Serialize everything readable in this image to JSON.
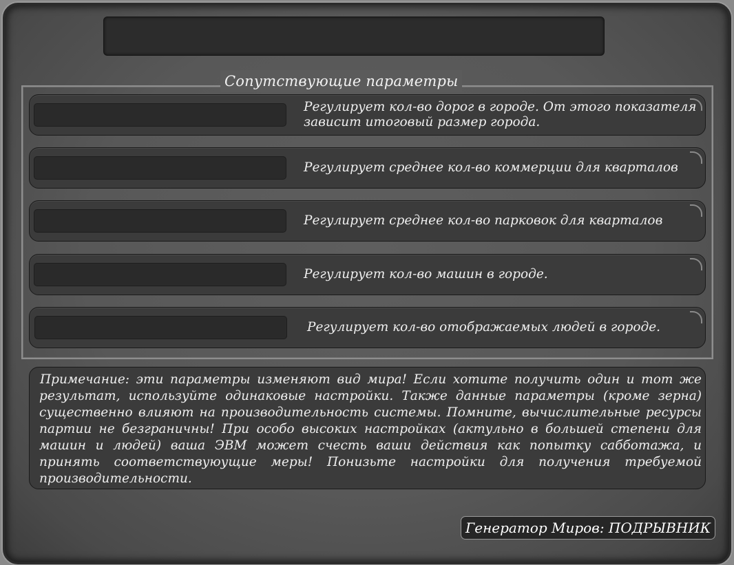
{
  "group": {
    "title": "Сопутствующие параметры"
  },
  "params": [
    {
      "description": "Регулирует кол-во дорог в городе. От этого показателя зависит итоговый размер города."
    },
    {
      "description": "Регулирует среднее кол-во коммерции для кварталов"
    },
    {
      "description": "Регулирует среднее кол-во парковок для кварталов"
    },
    {
      "description": "Регулирует кол-во машин в городе."
    },
    {
      "description": "Регулирует кол-во отображаемых людей в городе."
    }
  ],
  "note": {
    "text": "Примечание: эти параметры изменяют вид мира! Если хотите получить один и тот же результат, используйте одинаковые настройки. Также данные параметры (кроме зерна) существенно влияют на производительность системы. Помните, вычислительные ресурсы партии не безграничны! При особо высоких настройках (актульно в большей степени для машин и людей) ваша ЭВМ может счесть ваши действия как попытку саббота­жа, и принять соответствуюущие меры! Понизьте настройки для получения требуемой производительности."
  },
  "brand": {
    "label": "Генератор Миров: ПОДРЫВНИК"
  }
}
